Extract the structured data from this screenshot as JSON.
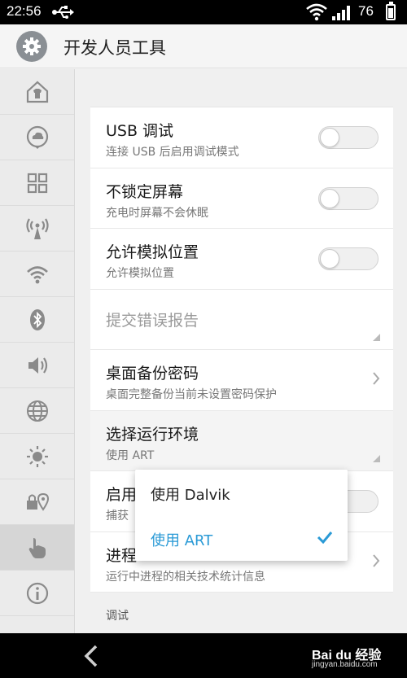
{
  "status_bar": {
    "time": "22:56",
    "battery": "76",
    "usb_icon": "usb-icon",
    "wifi_icon": "wifi-icon",
    "signal_icon": "signal-icon"
  },
  "header": {
    "title": "开发人员工具",
    "icon": "gear-icon"
  },
  "sidebar": {
    "items": [
      {
        "icon": "home-shirt-icon"
      },
      {
        "icon": "cloud-chat-icon"
      },
      {
        "icon": "grid-icon"
      },
      {
        "icon": "hotspot-icon"
      },
      {
        "icon": "wifi-icon"
      },
      {
        "icon": "bluetooth-icon"
      },
      {
        "icon": "volume-icon"
      },
      {
        "icon": "globe-icon"
      },
      {
        "icon": "brightness-icon"
      },
      {
        "icon": "lock-location-icon"
      },
      {
        "icon": "hand-pointer-icon"
      },
      {
        "icon": "info-icon"
      }
    ]
  },
  "settings": [
    {
      "title": "USB 调试",
      "subtitle": "连接 USB 后启用调试模式",
      "control": "toggle",
      "on": false
    },
    {
      "title": "不锁定屏幕",
      "subtitle": "充电时屏幕不会休眠",
      "control": "toggle",
      "on": false
    },
    {
      "title": "允许模拟位置",
      "subtitle": "允许模拟位置",
      "control": "toggle",
      "on": false
    },
    {
      "title": "提交错误报告",
      "subtitle": "",
      "control": "dropdown",
      "disabled": true
    },
    {
      "title": "桌面备份密码",
      "subtitle": "桌面完整备份当前未设置密码保护",
      "control": "chevron"
    },
    {
      "title": "选择运行环境",
      "subtitle": "使用 ART",
      "control": "dropdown"
    },
    {
      "title": "启用",
      "subtitle": "捕获",
      "control": "toggle",
      "on": false
    },
    {
      "title": "进程",
      "subtitle": "运行中进程的相关技术统计信息",
      "control": "chevron"
    }
  ],
  "section_label": "调试",
  "popup": {
    "options": [
      {
        "label": "使用 Dalvik",
        "selected": false
      },
      {
        "label": "使用 ART",
        "selected": true
      }
    ]
  },
  "navbar": {
    "back_icon": "back-arrow-icon"
  },
  "watermark": {
    "brand": "Bai du 经验",
    "url": "jingyan.baidu.com"
  },
  "colors": {
    "accent": "#2a9ad6",
    "status_bar": "#000000",
    "sidebar_bg": "#ebebeb"
  }
}
